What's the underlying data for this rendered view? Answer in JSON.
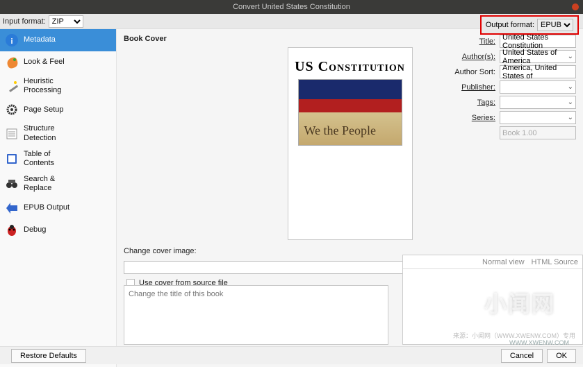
{
  "window": {
    "title": "Convert United States Constitution"
  },
  "format": {
    "input_label": "Input format:",
    "input_value": "ZIP",
    "output_label": "Output format:",
    "output_value": "EPUB"
  },
  "sidebar": {
    "items": [
      {
        "label": "Metadata"
      },
      {
        "label": "Look & Feel"
      },
      {
        "label": "Heuristic\nProcessing"
      },
      {
        "label": "Page Setup"
      },
      {
        "label": "Structure\nDetection"
      },
      {
        "label": "Table of\nContents"
      },
      {
        "label": "Search &\nReplace"
      },
      {
        "label": "EPUB Output"
      },
      {
        "label": "Debug"
      }
    ]
  },
  "cover": {
    "section": "Book Cover",
    "title_overlay1": "US Constitution",
    "script_text": "We the People",
    "change_label": "Change cover image:",
    "use_source_label": "Use cover from source file"
  },
  "meta": {
    "title_l": "Title:",
    "title_v": "United States Constitution",
    "author_l": "Author(s):",
    "author_v": "United States of America",
    "as_l": "Author Sort:",
    "as_v": "America, United States of",
    "pub_l": "Publisher:",
    "pub_v": "",
    "tags_l": "Tags:",
    "tags_v": "",
    "series_l": "Series:",
    "series_v": "",
    "book_no": "Book 1.00"
  },
  "editor": {
    "placeholder": "Change the title of this book"
  },
  "desc": {
    "tab1": "Normal view",
    "tab2": "HTML Source"
  },
  "buttons": {
    "restore": "Restore Defaults",
    "cancel": "Cancel",
    "ok": "OK"
  },
  "wm": {
    "big": "小闻网",
    "url": "WWW.XWENW.COM",
    "tag": "来源：小闻网（WWW.XWENW.COM）专用"
  }
}
